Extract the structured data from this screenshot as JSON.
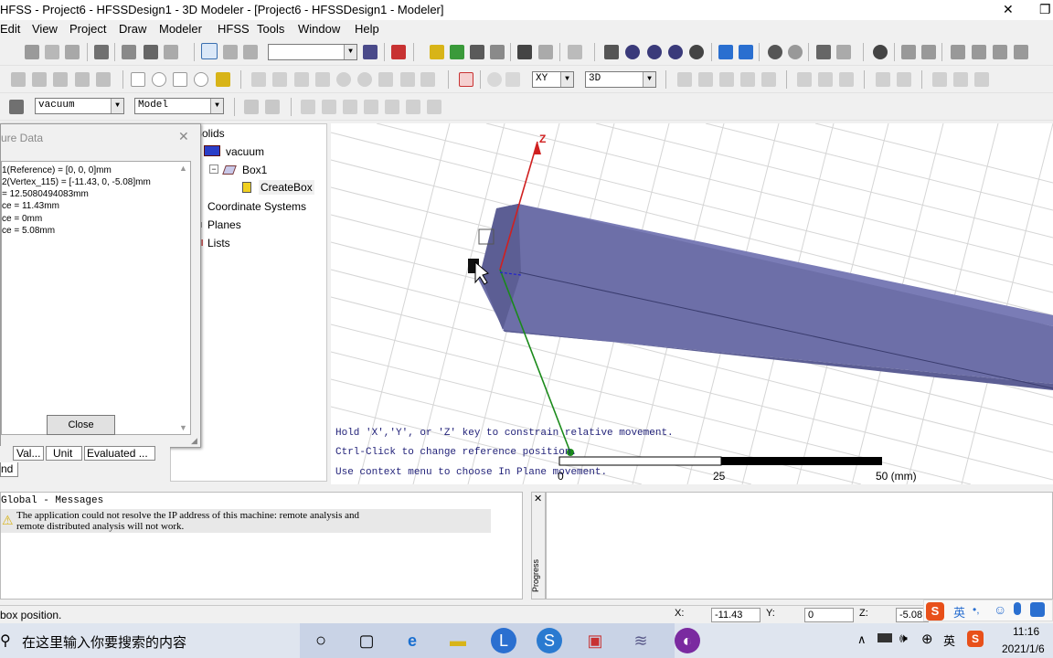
{
  "window": {
    "title": "HFSS - Project6 - HFSSDesign1 - 3D Modeler - [Project6 - HFSSDesign1 - Modeler]",
    "close_glyph": "✕",
    "restore_glyph": "❐"
  },
  "menu": [
    "Edit",
    "View",
    "Project",
    "Draw",
    "Modeler",
    "HFSS",
    "Tools",
    "Window",
    "Help"
  ],
  "toolbar": {
    "plane_select": "XY",
    "view_select": "3D",
    "material_select": "vacuum",
    "model_select": "Model",
    "colors": {
      "gray": "#7d7d7d",
      "blue": "#2a6fd0",
      "green": "#3a9a3a",
      "red": "#c83232",
      "yellow": "#d8b418"
    }
  },
  "dialog": {
    "title": "ure Data",
    "close_glyph": "✕",
    "lines": [
      "1(Reference) = [0, 0, 0]mm",
      "2(Vertex_115) = [-11.43, 0, -5.08]mm",
      " = 12.5080494083mm",
      "ce = 11.43mm",
      "ce = 0mm",
      "ce = 5.08mm"
    ],
    "close_button": "Close"
  },
  "tree": {
    "solids": "Solids",
    "vacuum": "vacuum",
    "box1": "Box1",
    "create_box": "CreateBox",
    "coord_systems": "Coordinate Systems",
    "planes": "Planes",
    "lists": "Lists"
  },
  "property_columns": [
    "Val...",
    "Unit",
    "Evaluated ..."
  ],
  "property_tab": "nd",
  "viewport": {
    "axis_z": "Z",
    "hints": [
      "Hold 'X','Y', or 'Z' key to constrain relative movement.",
      "Ctrl-Click to change reference position.",
      "Use context menu to choose In Plane movement."
    ],
    "scale_labels": [
      "0",
      "25",
      "50 (mm)"
    ],
    "colors": {
      "box_face": "#6d6fa8",
      "box_top": "#7a7cb6",
      "box_front": "#5c5e94",
      "grid": "#d5d5d5",
      "z_axis": "#d02020",
      "y_axis": "#1a8a1a",
      "hint_text": "#23237a"
    }
  },
  "messages": {
    "header": "Global - Messages",
    "warning_line1": "The application could not resolve the IP address of this machine: remote analysis and",
    "warning_line2": "remote distributed analysis will not work."
  },
  "progress_label": "Progress",
  "status": {
    "text": "box position.",
    "x_label": "X:",
    "x_value": "-11.43",
    "y_label": "Y:",
    "y_value": "0",
    "z_label": "Z:",
    "z_value": "-5.08"
  },
  "taskbar": {
    "search_placeholder": "在这里输入你要搜索的内容",
    "time": "11:16",
    "date": "2021/1/6",
    "ime_label": "英",
    "lang": "英"
  }
}
